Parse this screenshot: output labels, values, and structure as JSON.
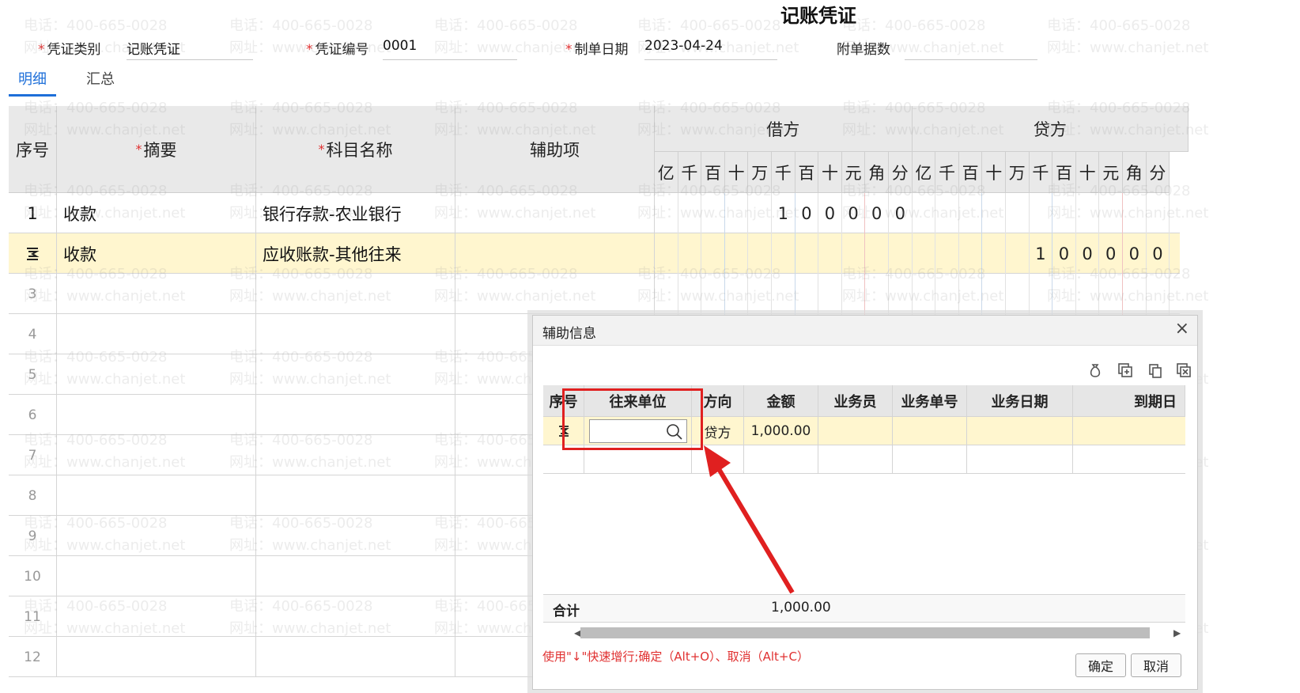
{
  "voucher": {
    "title": "记账凭证",
    "category_label": "凭证类别",
    "category_value": "记账凭证",
    "number_label": "凭证编号",
    "number_value": "0001",
    "date_label": "制单日期",
    "date_value": "2023-04-24",
    "attachments_label": "附单据数",
    "attachments_value": ""
  },
  "tabs": [
    {
      "label": "明细",
      "active": true
    },
    {
      "label": "汇总",
      "active": false
    }
  ],
  "grid": {
    "headers": {
      "seq": "序号",
      "summary": "摘要",
      "account": "科目名称",
      "aux": "辅助项",
      "debit": "借方",
      "credit": "贷方"
    },
    "digit_units": [
      "亿",
      "千",
      "百",
      "十",
      "万",
      "千",
      "百",
      "十",
      "元",
      "角",
      "分"
    ],
    "rows": [
      {
        "seq": "1",
        "summary": "收款",
        "account": "银行存款-农业银行",
        "aux": "",
        "debit": [
          "",
          "",
          "",
          "",
          "",
          "1",
          "0",
          "0",
          "0",
          "0",
          "0"
        ],
        "credit": [
          "",
          "",
          "",
          "",
          "",
          "",
          "",
          "",
          "",
          "",
          ""
        ],
        "selected": false
      },
      {
        "seq": "",
        "summary": "收款",
        "account": "应收账款-其他往来",
        "aux": "",
        "debit": [
          "",
          "",
          "",
          "",
          "",
          "",
          "",
          "",
          "",
          "",
          ""
        ],
        "credit": [
          "",
          "",
          "",
          "",
          "",
          "1",
          "0",
          "0",
          "0",
          "0",
          "0"
        ],
        "selected": true
      },
      {
        "seq": "3"
      },
      {
        "seq": "4"
      },
      {
        "seq": "5"
      },
      {
        "seq": "6"
      },
      {
        "seq": "7"
      },
      {
        "seq": "8"
      },
      {
        "seq": "9"
      },
      {
        "seq": "10"
      },
      {
        "seq": "11"
      },
      {
        "seq": "12"
      }
    ]
  },
  "dialog": {
    "title": "辅助信息",
    "close": "×",
    "toolbar_icons": [
      "money-bag-icon",
      "add-row-icon",
      "copy-icon",
      "delete-icon"
    ],
    "headers": [
      "序号",
      "往来单位",
      "方向",
      "金额",
      "业务员",
      "业务单号",
      "业务日期",
      "到期日"
    ],
    "row": {
      "seq": "",
      "partner": "",
      "direction": "贷方",
      "amount": "1,000.00",
      "salesperson": "",
      "doc_no": "",
      "doc_date": "",
      "due_date": ""
    },
    "total_label": "合计",
    "total_amount": "1,000.00",
    "hint": "使用\"↓\"快速增行;确定（Alt+O）、取消（Alt+C）",
    "ok_label": "确定",
    "cancel_label": "取消"
  },
  "watermark": {
    "phone": "电话：400-665-0028",
    "site": "网址：www.chanjet.net"
  },
  "colors": {
    "accent": "#1e6fd9",
    "required": "#e03030",
    "selected_row": "#fff6cf",
    "highlight_box": "#e02020"
  }
}
